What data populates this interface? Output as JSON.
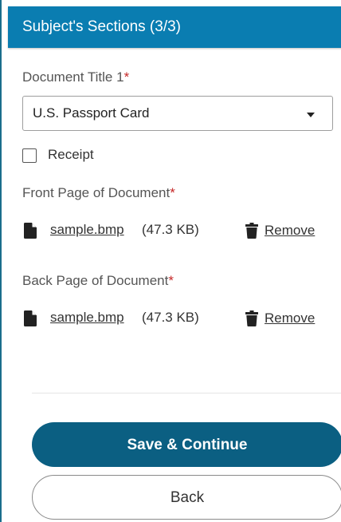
{
  "header": {
    "title": "Subject's Sections (3/3)"
  },
  "form": {
    "document_title": {
      "label": "Document Title 1",
      "required_mark": "*",
      "selected": "U.S. Passport Card"
    },
    "receipt": {
      "label": "Receipt",
      "checked": false
    },
    "front_page": {
      "label": "Front Page of Document",
      "required_mark": "*",
      "file_name": "sample.bmp",
      "file_size": "(47.3 KB)",
      "remove_label": "Remove"
    },
    "back_page": {
      "label": "Back Page of Document",
      "required_mark": "*",
      "file_name": "sample.bmp",
      "file_size": "(47.3 KB)",
      "remove_label": "Remove"
    }
  },
  "actions": {
    "save_label": "Save & Continue",
    "back_label": "Back"
  },
  "icons": {
    "file": "file-icon",
    "trash": "trash-icon",
    "caret": "chevron-down-icon"
  },
  "colors": {
    "header_bg": "#0a7db1",
    "primary_button": "#0b5f82",
    "required": "#c62828"
  }
}
